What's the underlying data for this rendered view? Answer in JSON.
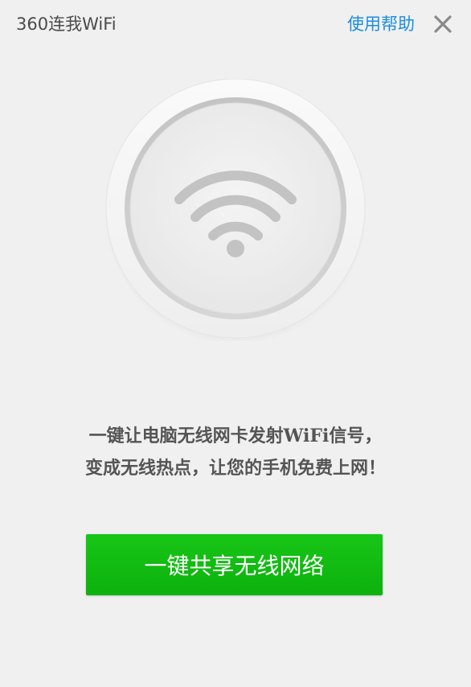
{
  "window": {
    "title": "360连我WiFi",
    "help_link": "使用帮助",
    "close_icon": "close-icon"
  },
  "hero": {
    "icon": "wifi-icon"
  },
  "message": {
    "line1": "一键让电脑无线网卡发射WiFi信号，",
    "line2": "变成无线热点，让您的手机免费上网！"
  },
  "actions": {
    "share_button_label": "一键共享无线网络"
  },
  "colors": {
    "background": "#f0f0f0",
    "link": "#1a8ee0",
    "button": "#12bb12",
    "text": "#555555"
  }
}
